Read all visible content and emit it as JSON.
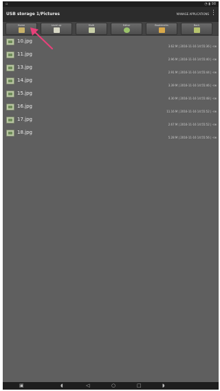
{
  "status_bar": {
    "right_text": "◔ ▮ 98"
  },
  "app_bar": {
    "path": "USB storage 1/Pictures",
    "manage_label": "MANAGE APPLICATIONS",
    "menu_icon": "⋮"
  },
  "toolbar": {
    "buttons": [
      {
        "label": "Home",
        "icon": "folder-icon",
        "color": "#c9b36a"
      },
      {
        "label": "Level up",
        "icon": "level-up-icon",
        "color": "#d7d7c5"
      },
      {
        "label": "Multi",
        "icon": "multi-icon",
        "color": "#c9d0a8"
      },
      {
        "label": "Editor",
        "icon": "editor-icon",
        "color": "#9bc36b"
      },
      {
        "label": "Bookmarks",
        "icon": "bookmark-icon",
        "color": "#d9a94a"
      },
      {
        "label": "Back",
        "icon": "back-icon",
        "color": "#b7c46e"
      }
    ]
  },
  "files": [
    {
      "name": "10.jpg",
      "meta": "3.62 M | 2016-11-16 14:55:36 | -rw"
    },
    {
      "name": "11.jpg",
      "meta": "2.96 M | 2016-11-16 14:55:40 | -rw"
    },
    {
      "name": "13.jpg",
      "meta": "2.91 M | 2016-11-16 14:55:44 | -rw"
    },
    {
      "name": "14.jpg",
      "meta": "3.39 M | 2016-11-16 14:55:46 | -rw"
    },
    {
      "name": "15.jpg",
      "meta": "4.30 M | 2016-11-16 14:55:48 | -rw"
    },
    {
      "name": "16.jpg",
      "meta": "11.16 M | 2016-11-16 14:55:52 | -rw"
    },
    {
      "name": "17.jpg",
      "meta": "2.67 M | 2016-11-16 14:55:52 | -rw"
    },
    {
      "name": "18.jpg",
      "meta": "5.28 M | 2016-11-16 14:55:56 | -rw"
    }
  ],
  "nav_bar": {
    "screenshot": "▣",
    "vol_down": "◖",
    "back": "◁",
    "home": "○",
    "recents": "□",
    "vol_up": "◗"
  },
  "colors": {
    "background": "#5f5f5f",
    "bars": "#1e1e1e",
    "appbar": "#2c2c2c",
    "arrow": "#e8417a"
  }
}
